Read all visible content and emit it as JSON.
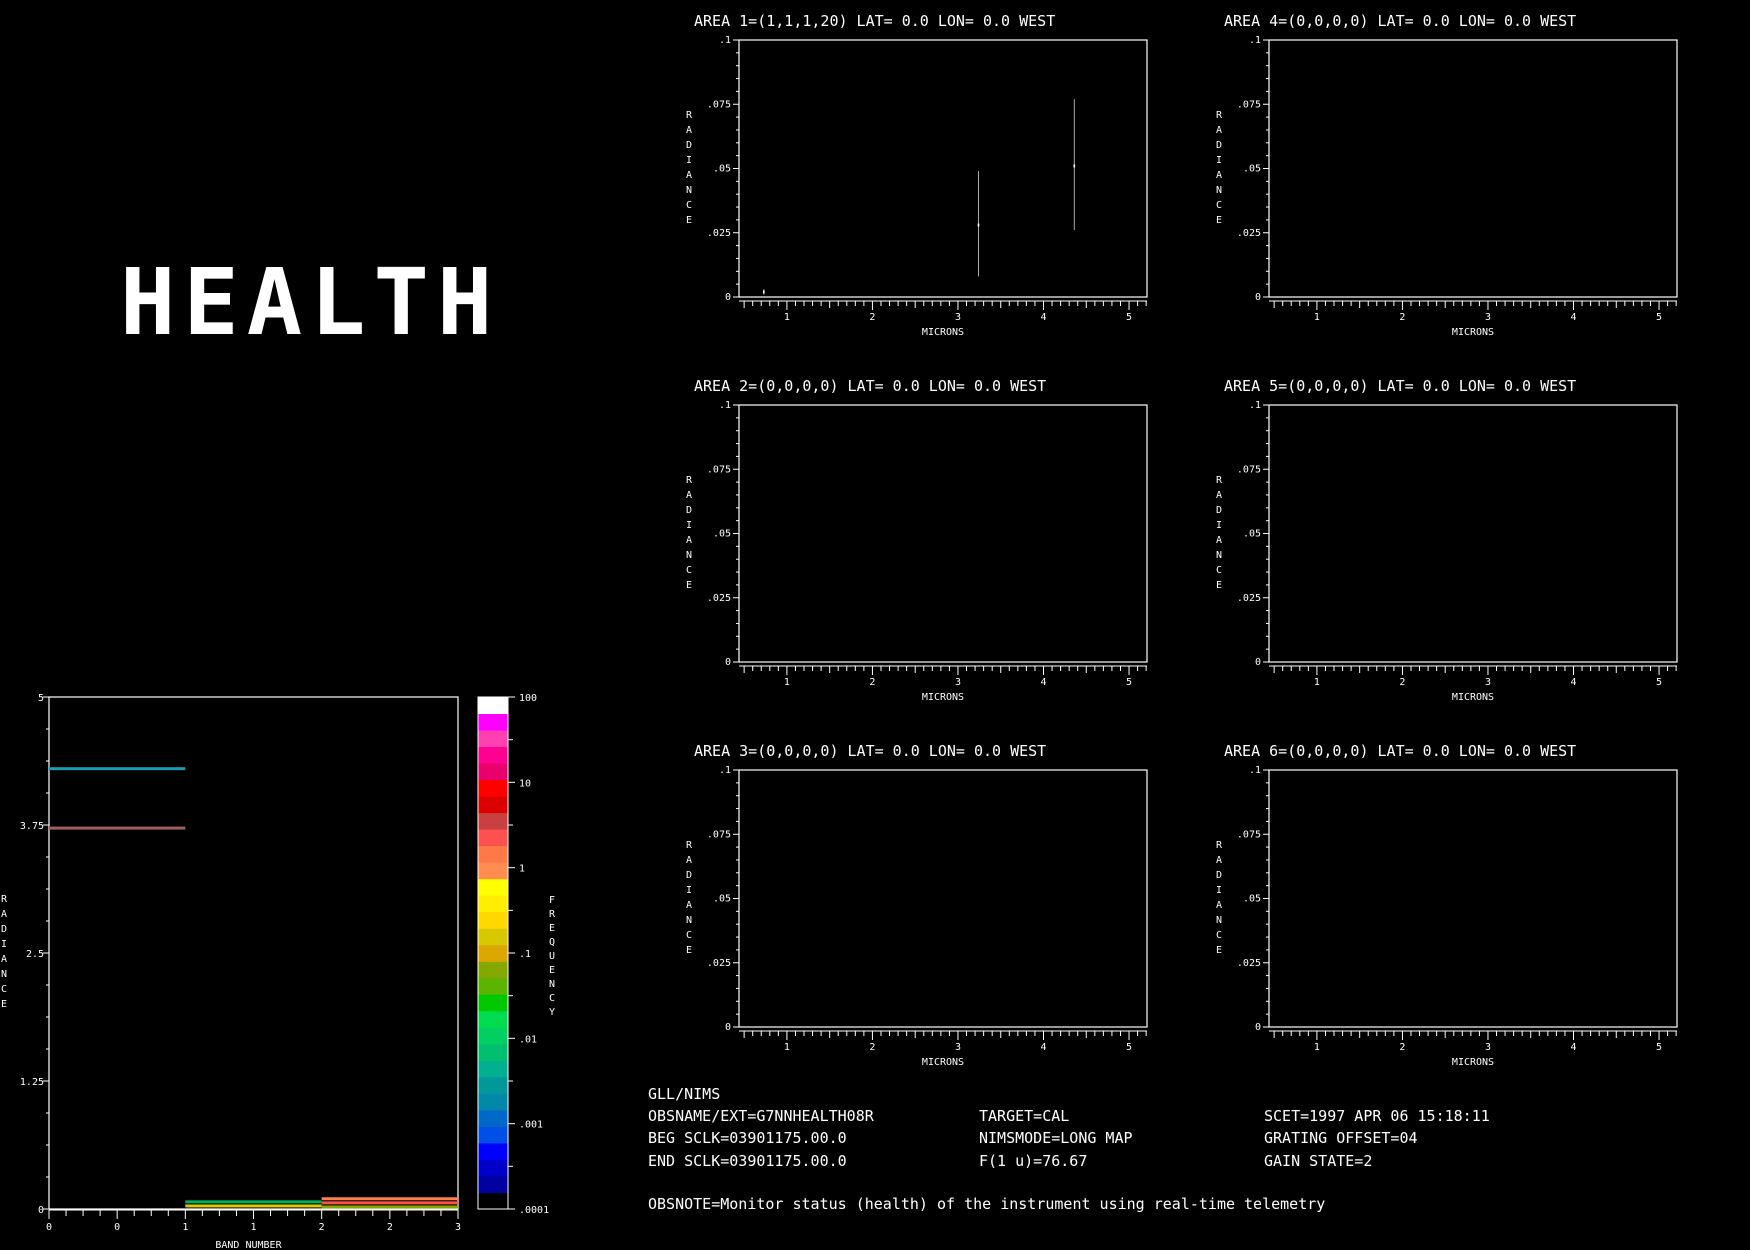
{
  "banner": "HEALTH",
  "area_panels": [
    {
      "title": "AREA 1=(1,1,1,20) LAT=   0.0 LON=   0.0 WEST",
      "points": [
        {
          "x": 0.73,
          "y": 0.002,
          "low": 0.001,
          "high": 0.003
        },
        {
          "x": 3.24,
          "y": 0.028,
          "low": 0.008,
          "high": 0.049
        },
        {
          "x": 4.36,
          "y": 0.051,
          "low": 0.026,
          "high": 0.077
        }
      ]
    },
    {
      "title": "AREA 2=(0,0,0,0) LAT=   0.0 LON=   0.0 WEST",
      "points": []
    },
    {
      "title": "AREA 3=(0,0,0,0) LAT=   0.0 LON=   0.0 WEST",
      "points": []
    },
    {
      "title": "AREA 4=(0,0,0,0) LAT=   0.0 LON=   0.0 WEST",
      "points": []
    },
    {
      "title": "AREA 5=(0,0,0,0) LAT=   0.0 LON=   0.0 WEST",
      "points": []
    },
    {
      "title": "AREA 6=(0,0,0,0) LAT=   0.0 LON=   0.0 WEST",
      "points": []
    }
  ],
  "area_axes": {
    "xlabel": "MICRONS",
    "ylabel": "RADIANCE",
    "xlim": [
      0.44,
      5.21
    ],
    "ylim": [
      0,
      0.1
    ],
    "xticks": [
      "1",
      "2",
      "3",
      "4",
      "5"
    ],
    "yticks": [
      "0",
      ".025",
      ".05",
      ".075",
      ".1"
    ]
  },
  "chart_data": {
    "type": "heatmap",
    "xlabel": "BAND NUMBER",
    "ylabel": "RADIANCE",
    "colorbar_label": "FREQUENCY",
    "xlim": [
      0,
      3
    ],
    "ylim": [
      0,
      5
    ],
    "xtick_labels": [
      "0",
      "0",
      "1",
      "1",
      "2",
      "2",
      "3"
    ],
    "ytick_labels": [
      "0",
      "1.25",
      "2.5",
      "3.75",
      "5"
    ],
    "colorbar_ticks": [
      ".0001",
      ".001",
      ".01",
      ".1",
      "1",
      "10",
      "100"
    ],
    "colorbar_scale": "log",
    "colorbar_range": [
      0.0001,
      100
    ],
    "colorbar_colors": [
      "#000000",
      "#0000a0",
      "#0000c8",
      "#0000ff",
      "#0050e8",
      "#0068c8",
      "#0088a8",
      "#009898",
      "#00b090",
      "#00c070",
      "#00d060",
      "#00dc50",
      "#00c800",
      "#5ab400",
      "#84a800",
      "#dca800",
      "#d8c800",
      "#ffd800",
      "#ffee00",
      "#ffff00",
      "#ff8c50",
      "#ff7848",
      "#ff5050",
      "#c84040",
      "#dd0000",
      "#ff0000",
      "#e8006c",
      "#ff0090",
      "#ff40b0",
      "#ff00ff",
      "#ffffff"
    ],
    "segments": [
      {
        "x0": 0,
        "x1": 1,
        "y": 4.3,
        "color": "#1a9fb0"
      },
      {
        "x0": 0,
        "x1": 1,
        "y": 3.72,
        "color": "#a06060"
      },
      {
        "x0": 1,
        "x1": 2,
        "y": 0.07,
        "color": "#00b060"
      },
      {
        "x0": 1,
        "x1": 2,
        "y": 0.03,
        "color": "#d8c800"
      },
      {
        "x0": 2,
        "x1": 3,
        "y": 0.1,
        "color": "#ff8048"
      },
      {
        "x0": 2,
        "x1": 3,
        "y": 0.06,
        "color": "#ff5050"
      },
      {
        "x0": 2,
        "x1": 3,
        "y": 0.02,
        "color": "#84a800"
      }
    ]
  },
  "info": {
    "instrument": "GLL/NIMS",
    "obsname": "OBSNAME/EXT=G7NNHEALTH08R",
    "beg_sclk": "BEG SCLK=03901175.00.0",
    "end_sclk": "END SCLK=03901175.00.0",
    "target": "TARGET=CAL",
    "nimsmode": "NIMSMODE=LONG MAP",
    "f1u": "F(1 u)=76.67",
    "scet": "SCET=1997 APR 06 15:18:11",
    "grating": "GRATING OFFSET=04",
    "gain": "GAIN STATE=2",
    "obsnote": "OBSNOTE=Monitor status (health) of the instrument using real-time telemetry"
  }
}
